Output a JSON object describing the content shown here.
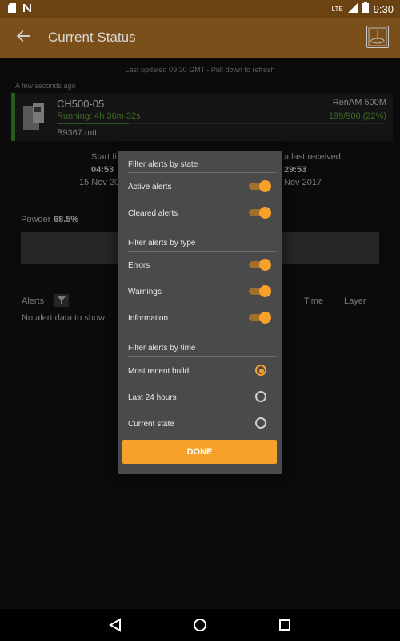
{
  "status_bar": {
    "time": "9:30",
    "network": "LTE"
  },
  "appbar": {
    "title": "Current Status"
  },
  "content": {
    "last_updated": "Last updated 09:30 GMT - Pull down to refresh",
    "ago": "A few seconds ago",
    "machine": {
      "name": "CH500-05",
      "model": "RenAM 500M",
      "running": "Running: 4h 36m 32s",
      "count": "199/900 (22%)",
      "progress": 0.22,
      "file": "B9367.mtt"
    },
    "background": {
      "start_label": "Start ti",
      "start_time": "04:53",
      "start_date": "15 Nov 20",
      "received_label": "a last received",
      "received_time": "29:53",
      "received_date": "Nov 2017",
      "powder_label": "Powder",
      "powder_value": "68.5%",
      "alerts": "Alerts",
      "time_col": "Time",
      "layer_col": "Layer",
      "no_alert": "No alert data to show"
    }
  },
  "dialog": {
    "section_state": "Filter alerts by state",
    "active": "Active alerts",
    "cleared": "Cleared alerts",
    "section_type": "Filter alerts by type",
    "errors": "Errors",
    "warnings": "Warnings",
    "information": "Information",
    "section_time": "Filter alerts by time",
    "most_recent": "Most recent build",
    "last24": "Last 24 hours",
    "current": "Current state",
    "done": "DONE"
  },
  "colors": {
    "accent": "#f7a02a",
    "appbar": "#7b4f1a",
    "running": "#3a8b28"
  }
}
